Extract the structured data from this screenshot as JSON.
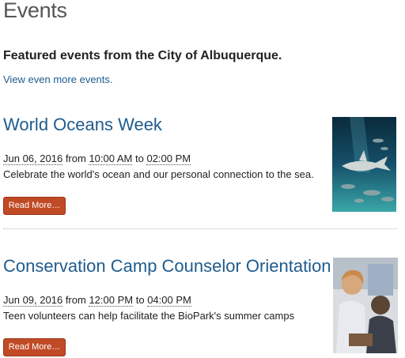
{
  "page": {
    "title": "Events",
    "intro": "Featured events from the City of Albuquerque.",
    "more_link": "View even more events."
  },
  "events": [
    {
      "title": "World Oceans Week",
      "date": "Jun 06, 2016",
      "from_word": "from",
      "start": "10:00 AM",
      "to_word": "to",
      "end": "02:00 PM",
      "description": "Celebrate the world's ocean and our personal connection to the sea.",
      "button": "Read More…"
    },
    {
      "title": "Conservation Camp Counselor Orientation",
      "date": "Jun 09, 2016",
      "from_word": "from",
      "start": "12:00 PM",
      "to_word": "to",
      "end": "04:00 PM",
      "description": "Teen volunteers can help facilitate the BioPark's summer camps",
      "button": "Read More…"
    }
  ],
  "colors": {
    "link": "#1f5c8e",
    "button": "#c14a26"
  }
}
